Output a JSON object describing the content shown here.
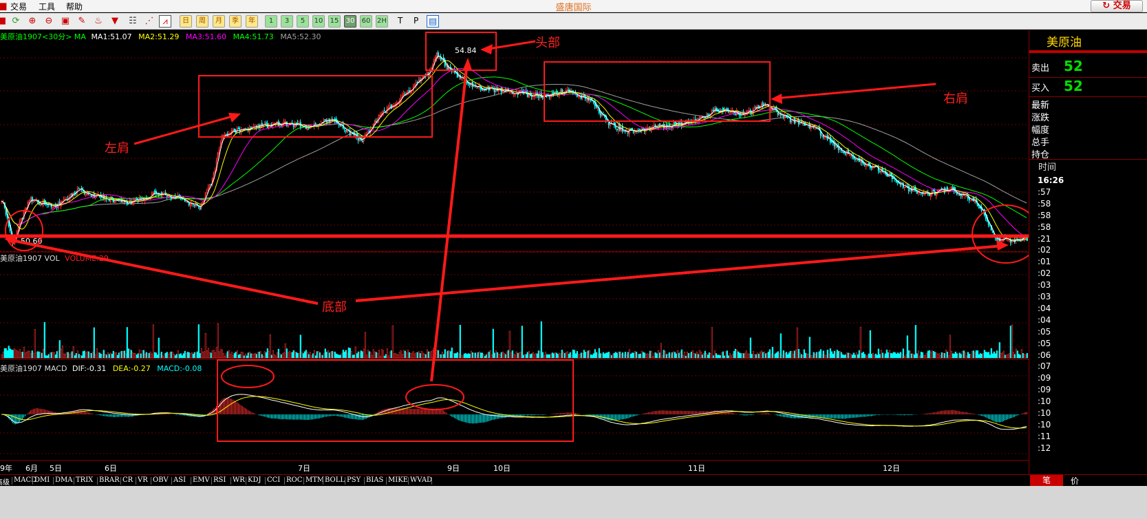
{
  "menu": {
    "items": [
      "交易",
      "工具",
      "帮助"
    ]
  },
  "app_title": "盛唐国际",
  "trade_button": "交易",
  "toolbar": {
    "periods": [
      "1",
      "5",
      "10",
      "15",
      "30",
      "60",
      "",
      "日",
      "周",
      "月",
      "季",
      "年"
    ],
    "period_glyph_1": "日",
    "period_glyph_2": "周",
    "period_glyph_3": "月",
    "period_glyph_4": "季",
    "period_glyph_5": "年",
    "min_1": "1",
    "min_3": "3",
    "min_5": "5",
    "min_10": "10",
    "min_15": "15",
    "min_30": "30",
    "min_60": "60",
    "min_2h": "2H",
    "t_label": "T",
    "p_label": "P",
    "colors": {
      "green_period": "#9be29b",
      "active_period": "#6fa06f"
    }
  },
  "chart": {
    "price_panel_header": {
      "name": "美原油1907<30分> MA",
      "ma1": "MA1:51.07",
      "ma2": "MA2:51.29",
      "ma3": "MA3:51.60",
      "ma4": "MA4:51.73",
      "ma5": "MA5:52.30"
    },
    "volume_panel_header": {
      "name": "美原油1907 VOL",
      "indicator": "VOLUME:29"
    },
    "macd_panel_header": {
      "name": "美原油1907 MACD",
      "dif": "DIF:-0.31",
      "dea": "DEA:-0.27",
      "macd": "MACD:-0.08"
    },
    "high_label": "54.84",
    "low_label": "50.60",
    "date_labels": [
      "9年",
      "6月",
      "5日",
      "6日",
      "7日",
      "9日",
      "10日",
      "11日",
      "12日"
    ],
    "annotations": {
      "head": "头部",
      "left_shoulder": "左肩",
      "right_shoulder": "右肩",
      "bottom": "底部"
    },
    "colors": {
      "up_candle": "#ff3030",
      "down_candle": "#00ffff",
      "ma1": "#ffffff",
      "ma2": "#ffff00",
      "ma3": "#ff00ff",
      "ma4": "#00ff00",
      "ma5": "#a0a0a0",
      "annotation": "#ff1a1a",
      "grid": "#700000"
    },
    "chart_data": {
      "type": "candlestick",
      "title": "",
      "xlabel": "",
      "ylabel": "",
      "date_ticks": [
        "9年",
        "6月",
        "5日",
        "6日",
        "7日",
        "9日",
        "10日",
        "11日",
        "12日"
      ],
      "ylim": [
        50.4,
        55.1
      ],
      "grid": true,
      "keypoints": [
        {
          "i": 0,
          "p": 51.6
        },
        {
          "i": 8,
          "p": 50.6
        },
        {
          "i": 20,
          "p": 51.6
        },
        {
          "i": 38,
          "p": 51.4
        },
        {
          "i": 55,
          "p": 51.8
        },
        {
          "i": 75,
          "p": 51.6
        },
        {
          "i": 92,
          "p": 51.5
        },
        {
          "i": 110,
          "p": 51.7
        },
        {
          "i": 130,
          "p": 51.6
        },
        {
          "i": 144,
          "p": 51.4
        },
        {
          "i": 153,
          "p": 52.0
        },
        {
          "i": 160,
          "p": 53.0
        },
        {
          "i": 168,
          "p": 53.1
        },
        {
          "i": 185,
          "p": 53.2
        },
        {
          "i": 205,
          "p": 53.3
        },
        {
          "i": 222,
          "p": 53.2
        },
        {
          "i": 240,
          "p": 53.4
        },
        {
          "i": 252,
          "p": 53.1
        },
        {
          "i": 262,
          "p": 52.9
        },
        {
          "i": 276,
          "p": 53.5
        },
        {
          "i": 292,
          "p": 53.9
        },
        {
          "i": 310,
          "p": 54.4
        },
        {
          "i": 316,
          "p": 54.84
        },
        {
          "i": 325,
          "p": 54.5
        },
        {
          "i": 345,
          "p": 54.1
        },
        {
          "i": 370,
          "p": 54.0
        },
        {
          "i": 392,
          "p": 53.9
        },
        {
          "i": 412,
          "p": 54.0
        },
        {
          "i": 428,
          "p": 53.8
        },
        {
          "i": 440,
          "p": 53.3
        },
        {
          "i": 455,
          "p": 53.1
        },
        {
          "i": 475,
          "p": 53.2
        },
        {
          "i": 500,
          "p": 53.3
        },
        {
          "i": 520,
          "p": 53.6
        },
        {
          "i": 540,
          "p": 53.5
        },
        {
          "i": 555,
          "p": 53.7
        },
        {
          "i": 570,
          "p": 53.4
        },
        {
          "i": 590,
          "p": 53.2
        },
        {
          "i": 605,
          "p": 52.8
        },
        {
          "i": 620,
          "p": 52.5
        },
        {
          "i": 640,
          "p": 52.2
        },
        {
          "i": 660,
          "p": 51.8
        },
        {
          "i": 672,
          "p": 51.7
        },
        {
          "i": 690,
          "p": 51.8
        },
        {
          "i": 705,
          "p": 51.6
        },
        {
          "i": 713,
          "p": 51.3
        },
        {
          "i": 722,
          "p": 50.7
        },
        {
          "i": 735,
          "p": 50.65
        },
        {
          "i": 745,
          "p": 50.7
        }
      ],
      "series": [
        {
          "name": "MA1"
        },
        {
          "name": "MA2"
        },
        {
          "name": "MA3"
        },
        {
          "name": "MA4"
        },
        {
          "name": "MA5"
        }
      ]
    }
  },
  "quote_panel": {
    "title": "美原油",
    "sell_label": "卖出",
    "sell_value": "52",
    "buy_label": "买入",
    "buy_value": "52",
    "fields": [
      "最新",
      "涨跌",
      "幅度",
      "总手",
      "持仓"
    ],
    "time_header": "时间",
    "ticks": [
      "16:26",
      ":57",
      ":58",
      ":58",
      ":58",
      ":21",
      ":02",
      ":01",
      ":02",
      ":03",
      ":03",
      ":04",
      ":04",
      ":05",
      ":05",
      ":06",
      ":07",
      ":09",
      ":09",
      ":10",
      ":10",
      ":10",
      ":11",
      ":12"
    ]
  },
  "tabs": [
    "高级",
    "MACD",
    "DMI",
    "DMA",
    "TRIX",
    "BRAR",
    "CR",
    "VR",
    "OBV",
    "ASI",
    "EMV",
    "RSI",
    "WR",
    "KDJ",
    "CCI",
    "ROC",
    "MTM",
    "BOLL",
    "PSY",
    "BIAS",
    "MIKE",
    "WVAD"
  ],
  "tab_pen": "笔",
  "tab_price": "价"
}
